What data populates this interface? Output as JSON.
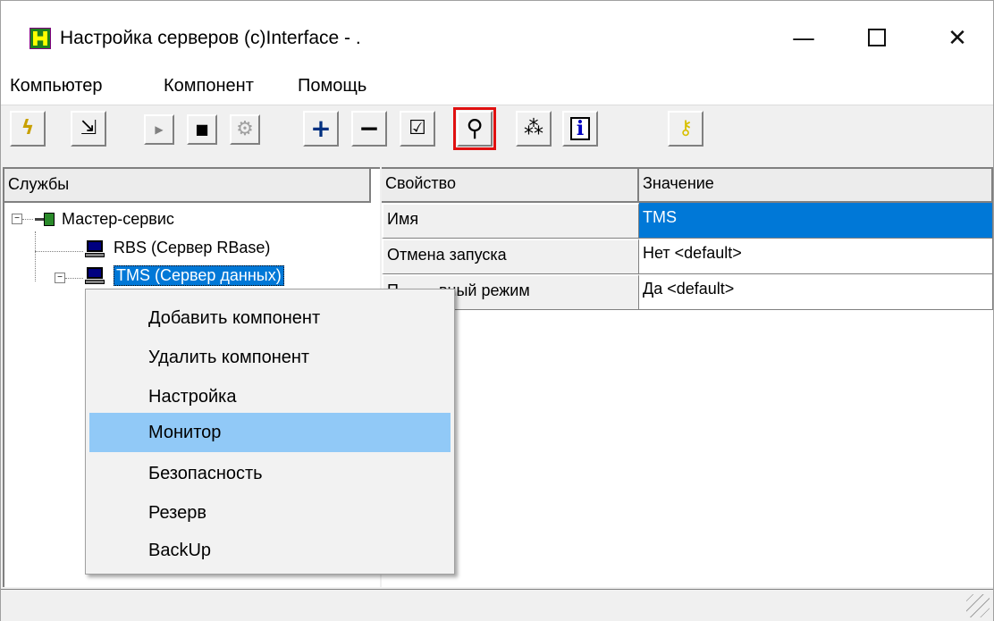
{
  "window": {
    "title": "Настройка серверов (c)Interface - .",
    "controls": {
      "minimize": "—",
      "close": "✕"
    }
  },
  "menubar": {
    "items": [
      "Компьютер",
      "Компонент",
      "Помощь"
    ]
  },
  "toolbar": {
    "buttons": [
      {
        "icon": "lightning-icon",
        "glyph": "ϟ"
      },
      {
        "icon": "export-icon",
        "glyph": "⇲"
      },
      {
        "icon": "play-icon",
        "glyph": "▶"
      },
      {
        "icon": "stop-icon",
        "glyph": "■"
      },
      {
        "icon": "components-icon",
        "glyph": "⚙"
      },
      {
        "icon": "add-icon",
        "glyph": "+"
      },
      {
        "icon": "remove-icon",
        "glyph": "−"
      },
      {
        "icon": "properties-icon",
        "glyph": "☑"
      },
      {
        "icon": "monitor-search-icon",
        "glyph": "⚲"
      },
      {
        "icon": "security-footprints-icon",
        "glyph": "⁂"
      },
      {
        "icon": "info-icon",
        "glyph": "i"
      },
      {
        "icon": "key-icon",
        "glyph": "⚷"
      }
    ],
    "highlight_color": "#e01010"
  },
  "tree": {
    "header": "Службы",
    "root": {
      "label": "Мастер-сервис",
      "expander": "−"
    },
    "children": [
      {
        "label": "RBS (Сервер RBase)"
      },
      {
        "label": "TMS (Сервер данных)",
        "expander": "−",
        "selected": true
      }
    ]
  },
  "properties": {
    "headers": [
      "Свойство",
      "Значение"
    ],
    "rows": [
      {
        "key": "Имя",
        "value": "TMS",
        "selected": true
      },
      {
        "key": "Отмена запуска",
        "value": "Нет <default>"
      },
      {
        "key": "П         вный режим",
        "value": "Да <default>"
      }
    ]
  },
  "context_menu": {
    "items": [
      "Добавить компонент",
      "Удалить компонент",
      "Настройка",
      "Монитор",
      "Безопасность",
      "Резерв",
      "BackUp"
    ],
    "hovered": "Монитор",
    "hover_color": "#91c9f7"
  },
  "colors": {
    "selection": "#0078d7"
  }
}
